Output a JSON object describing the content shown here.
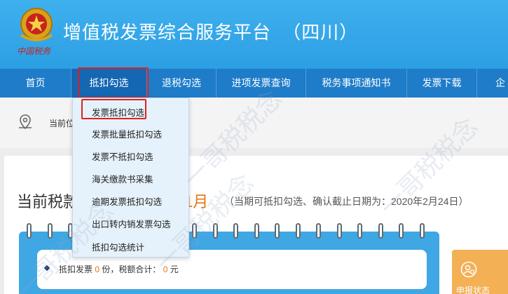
{
  "header": {
    "title": "增值税发票综合服务平台",
    "region": "（四川）",
    "emblem_caption": "中国税务"
  },
  "nav": {
    "items": [
      {
        "label": "首页"
      },
      {
        "label": "抵扣勾选"
      },
      {
        "label": "退税勾选"
      },
      {
        "label": "进项发票查询"
      },
      {
        "label": "税务事项通知书"
      },
      {
        "label": "发票下载"
      },
      {
        "label": "企"
      }
    ],
    "active_index": 1
  },
  "dropdown": {
    "items": [
      {
        "label": "发票抵扣勾选"
      },
      {
        "label": "发票批量抵扣勾选"
      },
      {
        "label": "发票不抵扣勾选"
      },
      {
        "label": "海关缴款书采集"
      },
      {
        "label": "逾期发票抵扣勾选"
      },
      {
        "label": "出口转内销发票勾选"
      },
      {
        "label": "抵扣勾选统计"
      }
    ],
    "highlighted_index": 0
  },
  "breadcrumb": {
    "label": "当前位"
  },
  "period": {
    "title": "当前税款",
    "month": "1月",
    "note": "（当期可抵扣勾选、确认截止日期为：2020年2月24日）"
  },
  "stats": {
    "prefix": "抵扣发票",
    "count": "0",
    "mid": "份，税额合计：",
    "amount": "0",
    "suffix": "元"
  },
  "side_card": {
    "label": "申报状态"
  },
  "watermark": "一哥税税念",
  "colors": {
    "header": "#3fb0ee",
    "nav": "#1e7cc9",
    "highlight_red": "#e02020",
    "accent_orange": "#e8730c",
    "calendar_blue": "#3fa7e3",
    "side_card": "#f3b054"
  }
}
